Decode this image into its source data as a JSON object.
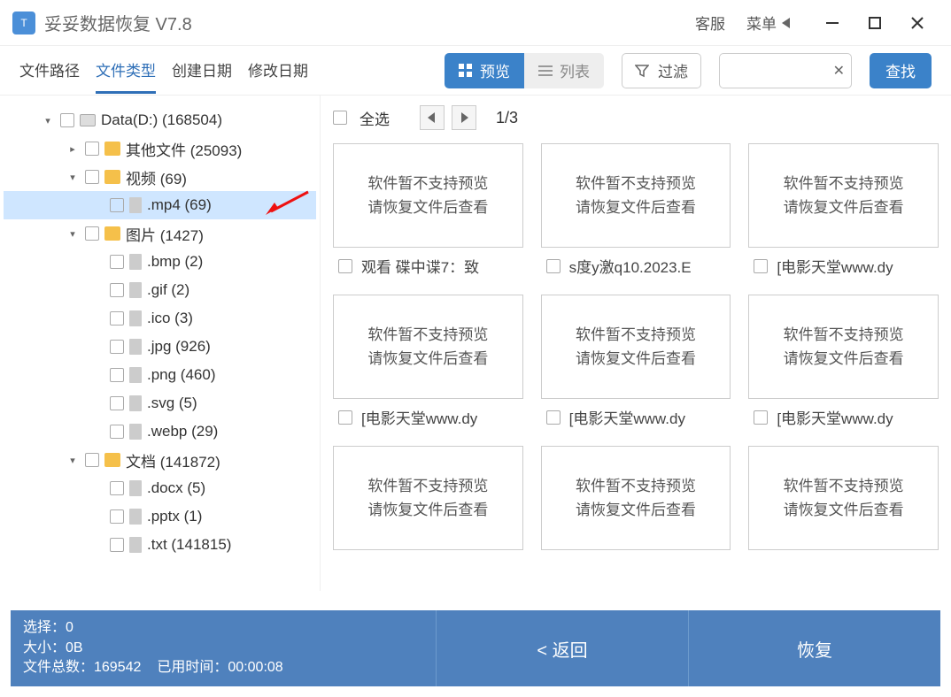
{
  "title": "妥妥数据恢复  V7.8",
  "titlebar": {
    "support": "客服",
    "menu": "菜单"
  },
  "tabs": [
    "文件路径",
    "文件类型",
    "创建日期",
    "修改日期"
  ],
  "activeTab": 1,
  "viewtoggle": {
    "preview": "预览",
    "list": "列表"
  },
  "filterLabel": "过滤",
  "searchBtn": "查找",
  "selectAll": "全选",
  "page": "1/3",
  "tree": [
    {
      "indent": 0,
      "exp": "▾",
      "icon": "disk",
      "label": "Data(D:)  (168504)"
    },
    {
      "indent": 1,
      "exp": "▸",
      "icon": "folder",
      "label": "其他文件  (25093)"
    },
    {
      "indent": 1,
      "exp": "▾",
      "icon": "folder",
      "label": "视频  (69)"
    },
    {
      "indent": 2,
      "exp": "",
      "icon": "file",
      "label": ".mp4  (69)",
      "selected": true
    },
    {
      "indent": 1,
      "exp": "▾",
      "icon": "folder",
      "label": "图片  (1427)"
    },
    {
      "indent": 2,
      "exp": "",
      "icon": "file",
      "label": ".bmp  (2)"
    },
    {
      "indent": 2,
      "exp": "",
      "icon": "file",
      "label": ".gif  (2)"
    },
    {
      "indent": 2,
      "exp": "",
      "icon": "file",
      "label": ".ico  (3)"
    },
    {
      "indent": 2,
      "exp": "",
      "icon": "file",
      "label": ".jpg  (926)"
    },
    {
      "indent": 2,
      "exp": "",
      "icon": "file",
      "label": ".png  (460)"
    },
    {
      "indent": 2,
      "exp": "",
      "icon": "file",
      "label": ".svg  (5)"
    },
    {
      "indent": 2,
      "exp": "",
      "icon": "file",
      "label": ".webp  (29)"
    },
    {
      "indent": 1,
      "exp": "▾",
      "icon": "folder",
      "label": "文档  (141872)"
    },
    {
      "indent": 2,
      "exp": "",
      "icon": "file",
      "label": ".docx  (5)"
    },
    {
      "indent": 2,
      "exp": "",
      "icon": "file",
      "label": ".pptx  (1)"
    },
    {
      "indent": 2,
      "exp": "",
      "icon": "file",
      "label": ".txt  (141815)"
    }
  ],
  "thumbText1": "软件暂不支持预览",
  "thumbText2": "请恢复文件后查看",
  "items": [
    {
      "name": "观看 碟中谍7：致"
    },
    {
      "name": "s度y激q10.2023.E"
    },
    {
      "name": "[电影天堂www.dy"
    },
    {
      "name": "[电影天堂www.dy"
    },
    {
      "name": "[电影天堂www.dy"
    },
    {
      "name": "[电影天堂www.dy"
    },
    {
      "name": ""
    },
    {
      "name": ""
    },
    {
      "name": ""
    }
  ],
  "footer": {
    "selected": "选择：0",
    "size": "大小：0B",
    "total": "文件总数：169542",
    "elapsed": "已用时间：00:00:08",
    "back": "< 返回",
    "recover": "恢复"
  }
}
